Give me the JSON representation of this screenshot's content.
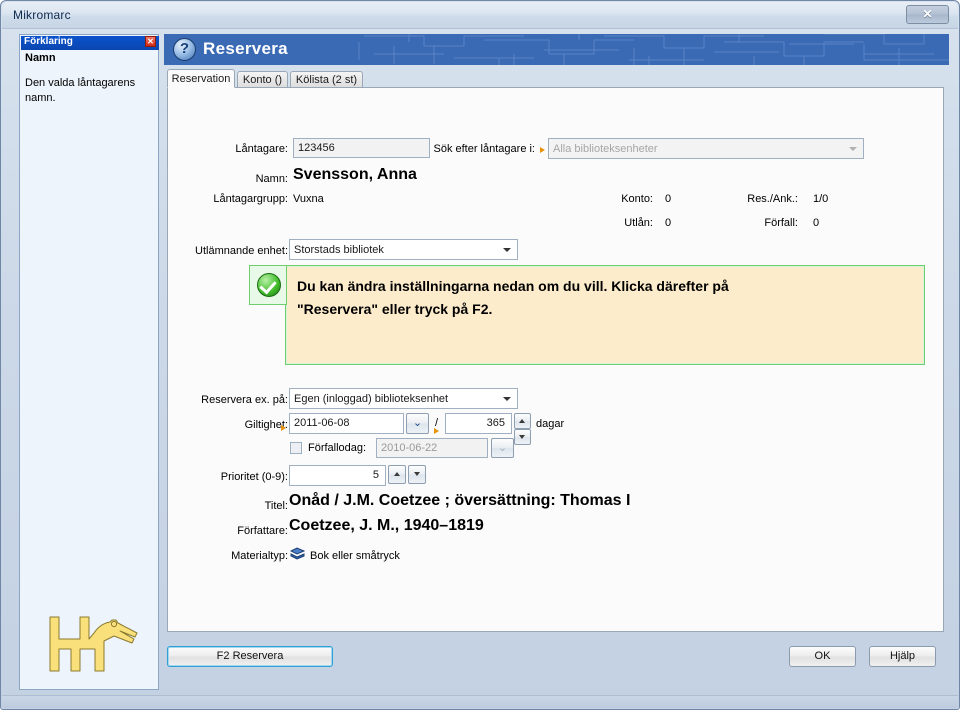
{
  "window": {
    "title": "Mikromarc",
    "close_label": "✕"
  },
  "explain_panel": {
    "header": "Förklaring",
    "close_label": "✕",
    "subject": "Namn",
    "body": "Den valda låntagarens namn.",
    "logo_name": "mikromarc-horse-logo"
  },
  "banner": {
    "help_icon": "question-mark-icon",
    "title": "Reservera"
  },
  "tabs": [
    {
      "label": "Reservation",
      "active": true
    },
    {
      "label": "Konto ()",
      "active": false
    },
    {
      "label": "Kölista (2 st)",
      "active": false
    }
  ],
  "form": {
    "borrower_label": "Låntagare:",
    "borrower_value": "123456",
    "search_in_label": "Sök efter låntagare i:",
    "search_in_value": "Alla biblioteksenheter",
    "name_label": "Namn:",
    "name_value": "Svensson, Anna",
    "group_label": "Låntagargrupp:",
    "group_value": "Vuxna",
    "unit_label": "Utlämnande enhet:",
    "unit_value": "Storstads bibliotek",
    "reserve_on_label": "Reservera ex. på:",
    "reserve_on_value": "Egen (inloggad) biblioteksenhet",
    "validity_label": "Giltighet:",
    "validity_date": "2011-06-08",
    "validity_sep": "/",
    "validity_days": "365",
    "days_unit": "dagar",
    "expiry_checkbox_label": "Förfallodag:",
    "expiry_date": "2010-06-22",
    "priority_label": "Prioritet (0-9):",
    "priority_value": "5",
    "title_label": "Titel:",
    "title_value": "Onåd / J.M. Coetzee ; översättning: Thomas I",
    "author_label": "Författare:",
    "author_value": "Coetzee, J. M., 1940–1819",
    "material_label": "Materialtyp:",
    "material_value": "Bok eller småtryck",
    "material_icon": "book-icon"
  },
  "stats": {
    "account_label": "Konto:",
    "account_value": "0",
    "res_ank_label": "Res./Ank.:",
    "res_ank_value": "1/0",
    "loans_label": "Utlån:",
    "loans_value": "0",
    "overdue_label": "Förfall:",
    "overdue_value": "0"
  },
  "message": {
    "icon": "success-check-icon",
    "line1": "Du kan ändra inställningarna nedan om du vill. Klicka därefter på",
    "line2": "\"Reservera\" eller tryck på F2."
  },
  "footer": {
    "reserve_button": "F2 Reservera",
    "ok_button": "OK",
    "help_button": "Hjälp"
  },
  "colors": {
    "banner_blue": "#3b6ab4",
    "explain_header_blue": "#0a50c8",
    "message_border_green": "#6fcc6f",
    "message_bg_yellow": "#fdeccc",
    "marker_orange": "#e8930c",
    "logo_yellow": "#f9e07a"
  }
}
